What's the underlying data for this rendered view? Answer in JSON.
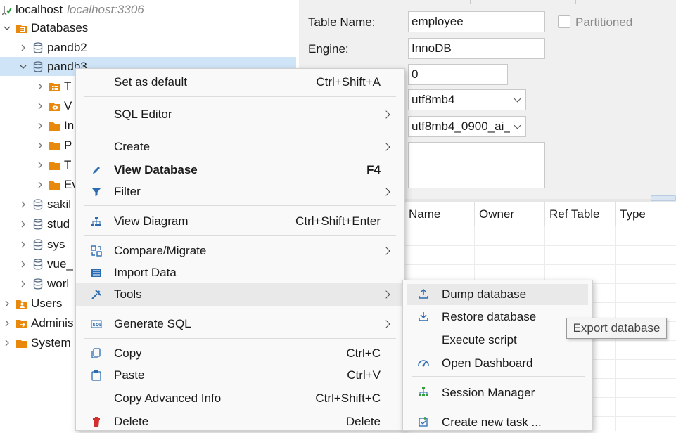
{
  "colors": {
    "selection": "#cfe5f7",
    "menu_bg": "#f9f9f9",
    "menu_highlight": "#e9e9e9",
    "db_icon": "#5a6f86",
    "folder_icon": "#e8890c",
    "menu_icon": "#2b6cb0",
    "delete_icon": "#d32f2f"
  },
  "tree": {
    "connection": {
      "name": "localhost",
      "host": "localhost:3306"
    },
    "databases_label": "Databases",
    "databases": [
      {
        "name": "pandb2"
      },
      {
        "name": "pandb3",
        "visible": "pandb3"
      },
      {
        "name": "sakil"
      },
      {
        "name": "stud"
      },
      {
        "name": "sys"
      },
      {
        "name": "vue_"
      },
      {
        "name": "worl"
      }
    ],
    "pandb3_children": [
      "T",
      "V",
      "In",
      "P",
      "T",
      "Ev"
    ],
    "other_nodes": [
      "Users",
      "Adminis",
      "System"
    ]
  },
  "editor": {
    "table_name_label": "Table Name:",
    "table_name_value": "employee",
    "engine_label": "Engine:",
    "engine_value": "InnoDB",
    "auto_increment_value": "0",
    "charset_value": "utf8mb4",
    "collation_value": "utf8mb4_0900_ai_",
    "partitioned_label": "Partitioned",
    "columns": [
      "Name",
      "Owner",
      "Ref Table",
      "Type"
    ]
  },
  "context_menu": {
    "items": [
      {
        "label": "Set as default",
        "shortcut": "Ctrl+Shift+A",
        "icon": "none"
      },
      {
        "label": "SQL Editor",
        "submenu": true,
        "icon": "none"
      },
      {
        "label": "Create",
        "submenu": true,
        "icon": "none"
      },
      {
        "label": "View Database",
        "shortcut": "F4",
        "icon": "pencil-icon",
        "bold": true
      },
      {
        "label": "Filter",
        "submenu": true,
        "icon": "filter-icon"
      },
      {
        "label": "View Diagram",
        "shortcut": "Ctrl+Shift+Enter",
        "icon": "diagram-icon"
      },
      {
        "label": "Compare/Migrate",
        "submenu": true,
        "icon": "compare-icon"
      },
      {
        "label": "Import Data",
        "icon": "import-icon"
      },
      {
        "label": "Tools",
        "submenu": true,
        "icon": "tools-icon"
      },
      {
        "label": "Generate SQL",
        "submenu": true,
        "icon": "sql-icon"
      },
      {
        "label": "Copy",
        "shortcut": "Ctrl+C",
        "icon": "copy-icon"
      },
      {
        "label": "Paste",
        "shortcut": "Ctrl+V",
        "icon": "paste-icon"
      },
      {
        "label": "Copy Advanced Info",
        "shortcut": "Ctrl+Shift+C",
        "icon": "none"
      },
      {
        "label": "Delete",
        "shortcut": "Delete",
        "icon": "delete-icon"
      }
    ]
  },
  "tools_submenu": {
    "items": [
      {
        "label": "Dump database",
        "icon": "upload-icon"
      },
      {
        "label": "Restore database",
        "icon": "download-icon"
      },
      {
        "label": "Execute script",
        "icon": "none"
      },
      {
        "label": "Open Dashboard",
        "icon": "dashboard-icon"
      },
      {
        "label": "Session Manager",
        "icon": "sessions-icon"
      },
      {
        "label": "Create new task ...",
        "icon": "task-icon"
      }
    ]
  },
  "tooltip": "Export database"
}
